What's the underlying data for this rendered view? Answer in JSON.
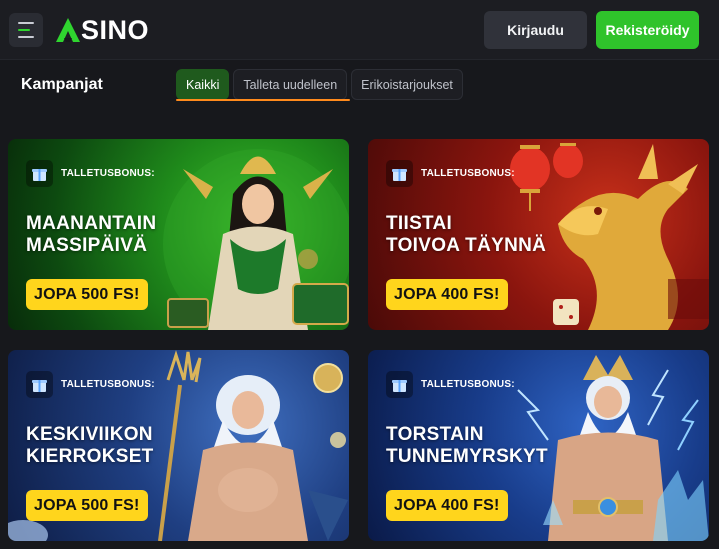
{
  "header": {
    "logo_text": "SINO",
    "login_label": "Kirjaudu",
    "register_label": "Rekisteröidy"
  },
  "page": {
    "title": "Kampanjat",
    "tabs": [
      {
        "label": "Kaikki",
        "active": true
      },
      {
        "label": "Talleta uudelleen",
        "active": false
      },
      {
        "label": "Erikoistarjoukset",
        "active": false
      }
    ]
  },
  "promos": [
    {
      "badge": "TALLETUSBONUS:",
      "line1": "MAANANTAIN",
      "line2": "MASSIPÄIVÄ",
      "offer": "JOPA 500 FS!"
    },
    {
      "badge": "TALLETUSBONUS:",
      "line1": "TIISTAI",
      "line2": "TOIVOA TÄYNNÄ",
      "offer": "JOPA 400 FS!"
    },
    {
      "badge": "TALLETUSBONUS:",
      "line1": "KESKIVIIKON",
      "line2": "KIERROKSET",
      "offer": "JOPA 500 FS!"
    },
    {
      "badge": "TALLETUSBONUS:",
      "line1": "TORSTAIN",
      "line2": "TUNNEMYRSKYT",
      "offer": "JOPA 400 FS!"
    }
  ],
  "colors": {
    "accent_green": "#2fc32b",
    "tab_underline": "#ff8a1c",
    "offer_yellow": "#ffd51c"
  },
  "icons": [
    "menu-icon",
    "logo-icon",
    "gift-icon"
  ]
}
